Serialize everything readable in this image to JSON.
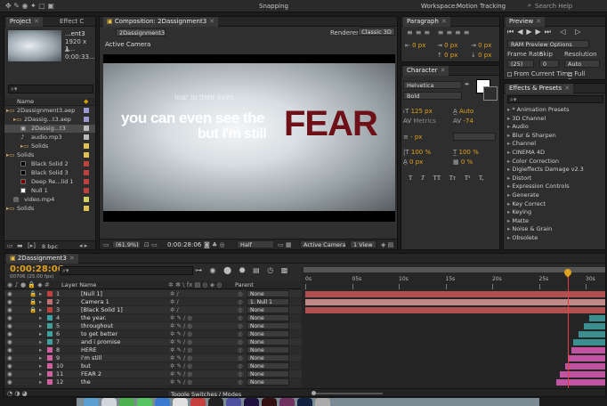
{
  "topbar": {
    "snapping": "Snapping",
    "workspace_label": "Workspace:",
    "workspace_value": "Motion Tracking",
    "search": "Search Help"
  },
  "project": {
    "tab": "Project",
    "tab2": "Effect C",
    "info": {
      "name": "...ent3",
      "size": "1920 x 1...",
      "duration": "Δ 0:00:33..."
    },
    "col_name": "Name",
    "items": [
      {
        "label": "2Dassignment3.aep",
        "indent": 0,
        "type": "folder",
        "color": "#9a9ad0"
      },
      {
        "label": "2Dassig...t3.aep",
        "indent": 1,
        "type": "folder",
        "color": "#9a9ad0"
      },
      {
        "label": "2Dassig...t3",
        "indent": 2,
        "type": "comp",
        "color": "#bbbbbb",
        "selected": true
      },
      {
        "label": "audio.mp3",
        "indent": 2,
        "type": "audio",
        "color": "#bbbbbb"
      },
      {
        "label": "Solids",
        "indent": 2,
        "type": "folder",
        "color": "#e0c050"
      },
      {
        "label": "Solids",
        "indent": 0,
        "type": "folder",
        "color": "#e0c050"
      },
      {
        "label": "Black Solid 2",
        "indent": 2,
        "type": "solid-black",
        "color": "#c04040"
      },
      {
        "label": "Black Solid 3",
        "indent": 2,
        "type": "solid-black",
        "color": "#c04040"
      },
      {
        "label": "Deep Re...lid 1",
        "indent": 2,
        "type": "solid-red",
        "color": "#c04040"
      },
      {
        "label": "Null 1",
        "indent": 2,
        "type": "solid-white",
        "color": "#c04040"
      },
      {
        "label": "video.mp4",
        "indent": 1,
        "type": "video",
        "color": "#d0d060"
      },
      {
        "label": "Solids",
        "indent": 0,
        "type": "folder",
        "color": "#e0c050"
      }
    ],
    "bpc": "8 bpc"
  },
  "composition": {
    "tab": "Composition: 2Dassignment3",
    "comp_button": "2Dassignment3",
    "renderer_label": "Renderer:",
    "renderer_value": "Classic 3D",
    "active_camera_label": "Active Camera",
    "line1": "tear to their eyes.",
    "line2": "you can even see the",
    "line3": "but i'm still",
    "line4": "FEAR",
    "zoom": "(61.9%)",
    "timecode": "0:00:28:06",
    "resolution": "Half",
    "camera": "Active Camera",
    "view": "1 View"
  },
  "paragraph": {
    "tab": "Paragraph",
    "fields": [
      "0 px",
      "0 px",
      "0 px",
      "0 px",
      "0 px"
    ]
  },
  "character": {
    "tab": "Character",
    "font": "Helvetica",
    "style": "Bold",
    "size": "125 px",
    "leading": "Auto",
    "kerning": "Metrics",
    "tracking": "-74",
    "stroke": "- px",
    "vscale": "100 %",
    "hscale": "100 %",
    "baseline": "0 px",
    "tsume": "0 %",
    "styles": [
      "T",
      "T",
      "TT",
      "Tт",
      "T¹",
      "T,"
    ]
  },
  "preview": {
    "tab": "Preview",
    "ram": "RAM Preview Options",
    "frame_rate_label": "Frame Rate",
    "skip_label": "Skip",
    "resolution_label": "Resolution",
    "frame_rate": "(25)",
    "skip": "0",
    "resolution": "Auto",
    "from_current": "From Current Time",
    "full_screen": "Full Screen"
  },
  "effects": {
    "tab": "Effects & Presets",
    "items": [
      "* Animation Presets",
      "3D Channel",
      "Audio",
      "Blur & Sharpen",
      "Channel",
      "CINEMA 4D",
      "Color Correction",
      "Digieffects Damage v2.3",
      "Distort",
      "Expression Controls",
      "Generate",
      "Key Correct",
      "Keying",
      "Matte",
      "Noise & Grain",
      "Obsolete"
    ]
  },
  "timeline": {
    "tab": "2Dassignment3",
    "timecode": "0:00:28:06",
    "frame_info": "00706 (25.00 fps)",
    "col_layer": "Layer Name",
    "col_parent": "Parent",
    "ruler": [
      "0s",
      "05s",
      "10s",
      "15s",
      "20s",
      "25s",
      "30s"
    ],
    "toggle": "Toggle Switches / Modes",
    "layers": [
      {
        "num": "1",
        "name": "[Null 1]",
        "color": "#c04040",
        "parent": "None"
      },
      {
        "num": "2",
        "name": "Camera 1",
        "color": "#c07070",
        "parent": "1. Null 1"
      },
      {
        "num": "3",
        "name": "[Black Solid 1]",
        "color": "#c04040",
        "parent": "None"
      },
      {
        "num": "4",
        "name": "the year.",
        "color": "#3fa0a0",
        "parent": "None"
      },
      {
        "num": "5",
        "name": "throughout",
        "color": "#3fa0a0",
        "parent": "None"
      },
      {
        "num": "6",
        "name": "to get better",
        "color": "#3fa0a0",
        "parent": "None"
      },
      {
        "num": "7",
        "name": "and i promise",
        "color": "#3fa0a0",
        "parent": "None"
      },
      {
        "num": "8",
        "name": "HERE",
        "color": "#d060a0",
        "parent": "None"
      },
      {
        "num": "9",
        "name": "i'm still",
        "color": "#d060a0",
        "parent": "None"
      },
      {
        "num": "10",
        "name": "but",
        "color": "#d060a0",
        "parent": "None"
      },
      {
        "num": "11",
        "name": "FEAR 2",
        "color": "#d060a0",
        "parent": "None"
      },
      {
        "num": "12",
        "name": "the",
        "color": "#d060a0",
        "parent": "None"
      }
    ]
  }
}
